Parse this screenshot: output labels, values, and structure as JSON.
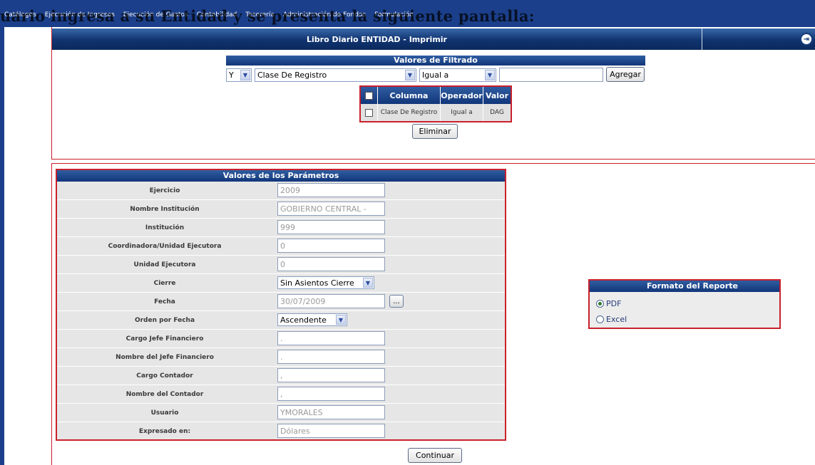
{
  "menu": {
    "items": [
      "Catálogos",
      "Ejecución de Ingresos",
      "Ejecución de Gastos",
      "Contabilidad",
      "Tesorería",
      "Administración de Fondos",
      "Formulación"
    ]
  },
  "overlay_caption": "uario ingresa a su Entidad y se presenta la siguiente pantalla:",
  "title": "Libro Diario ENTIDAD - Imprimir",
  "filter": {
    "header": "Valores de Filtrado",
    "connector": "Y",
    "column": "Clase De Registro",
    "operator": "Igual a",
    "value": "",
    "add_label": "Agregar",
    "table": {
      "headers": [
        "Columna",
        "Operador",
        "Valor"
      ],
      "rows": [
        {
          "columna": "Clase De Registro",
          "operador": "Igual a",
          "valor": "DAG"
        }
      ]
    },
    "delete_label": "Eliminar"
  },
  "params": {
    "header": "Valores de los Parámetros",
    "rows": [
      {
        "label": "Ejercicio",
        "value": "2009"
      },
      {
        "label": "Nombre Institución",
        "value": "GOBIERNO CENTRAL -"
      },
      {
        "label": "Institución",
        "value": "999"
      },
      {
        "label": "Coordinadora/Unidad Ejecutora",
        "value": "0"
      },
      {
        "label": "Unidad Ejecutora",
        "value": "0"
      },
      {
        "label": "Cierre",
        "value": "Sin Asientos Cierre"
      },
      {
        "label": "Fecha",
        "value": "30/07/2009"
      },
      {
        "label": "Orden por Fecha",
        "value": "Ascendente"
      },
      {
        "label": "Cargo Jefe Financiero",
        "value": "."
      },
      {
        "label": "Nombre del Jefe Financiero",
        "value": "."
      },
      {
        "label": "Cargo Contador",
        "value": ","
      },
      {
        "label": "Nombre del Contador",
        "value": ","
      },
      {
        "label": "Usuario",
        "value": "YMORALES"
      },
      {
        "label": "Expresado en:",
        "value": "Dólares"
      }
    ],
    "date_button_label": "..."
  },
  "format": {
    "header": "Formato del Reporte",
    "options": [
      {
        "label": "PDF",
        "selected": true
      },
      {
        "label": "Excel",
        "selected": false
      }
    ]
  },
  "continue_label": "Continuar",
  "colors": {
    "frame": "#1b3f8a",
    "header_gradient": "#12367a",
    "border_accent": "#c9202c",
    "panel_gray": "#e6e6e6"
  },
  "icons": {
    "exit": "exit-icon",
    "dropdown": "chevron-down-icon"
  }
}
